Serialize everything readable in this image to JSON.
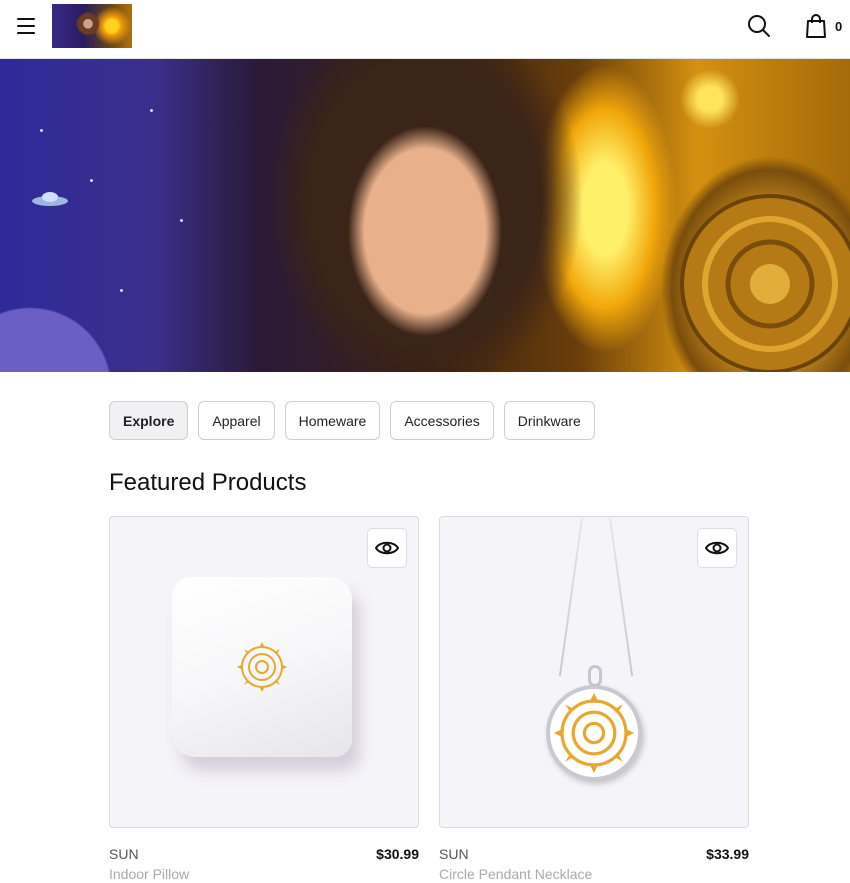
{
  "header": {
    "menu_icon": "hamburger-menu-icon",
    "logo_icon": "store-logo",
    "search_icon": "search-icon",
    "cart_icon": "shopping-bag-icon",
    "cart_count": "0"
  },
  "hero": {
    "image": "hero-banner-woman-sun-portal"
  },
  "tabs": [
    {
      "label": "Explore",
      "active": true
    },
    {
      "label": "Apparel",
      "active": false
    },
    {
      "label": "Homeware",
      "active": false
    },
    {
      "label": "Accessories",
      "active": false
    },
    {
      "label": "Drinkware",
      "active": false
    }
  ],
  "featured": {
    "title": "Featured Products",
    "products": [
      {
        "brand": "SUN",
        "name": "Indoor Pillow",
        "price": "$30.99",
        "image": "pillow-with-sun-print",
        "quick_view_icon": "eye-icon"
      },
      {
        "brand": "SUN",
        "name": "Circle Pendant Necklace",
        "price": "$33.99",
        "image": "necklace-with-sun-pendant",
        "quick_view_icon": "eye-icon"
      }
    ]
  },
  "colors": {
    "sun_print": "#e8a830",
    "border": "#d9d9df",
    "card_bg": "#f5f4f8"
  }
}
